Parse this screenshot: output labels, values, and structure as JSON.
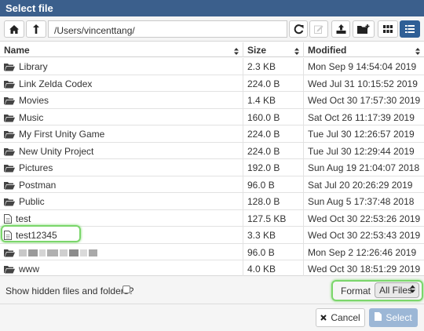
{
  "dialog": {
    "title": "Select file"
  },
  "toolbar": {
    "path": "/Users/vincenttang/",
    "buttons": {
      "home": "home-icon",
      "up": "arrow-up-icon",
      "refresh": "refresh-icon",
      "edit": "pencil-icon",
      "upload": "upload-icon",
      "new_folder": "folder-plus-icon",
      "grid_view": "grid-icon",
      "list_view": "list-icon"
    }
  },
  "table": {
    "columns": [
      "Name",
      "Size",
      "Modified"
    ],
    "rows": [
      {
        "type": "folder",
        "name": "Library",
        "size": "2.3 KB",
        "modified": "Mon Sep 9 14:54:04 2019"
      },
      {
        "type": "folder",
        "name": "Link Zelda Codex",
        "size": "224.0 B",
        "modified": "Wed Jul 31 10:15:52 2019"
      },
      {
        "type": "folder",
        "name": "Movies",
        "size": "1.4 KB",
        "modified": "Wed Oct 30 17:57:30 2019"
      },
      {
        "type": "folder",
        "name": "Music",
        "size": "160.0 B",
        "modified": "Sat Oct 26 11:17:39 2019"
      },
      {
        "type": "folder",
        "name": "My First Unity Game",
        "size": "224.0 B",
        "modified": "Tue Jul 30 12:26:57 2019"
      },
      {
        "type": "folder",
        "name": "New Unity Project",
        "size": "224.0 B",
        "modified": "Tue Jul 30 12:29:44 2019"
      },
      {
        "type": "folder",
        "name": "Pictures",
        "size": "192.0 B",
        "modified": "Sun Aug 19 21:04:07 2018"
      },
      {
        "type": "folder",
        "name": "Postman",
        "size": "96.0 B",
        "modified": "Sat Jul 20 20:26:29 2019"
      },
      {
        "type": "folder",
        "name": "Public",
        "size": "128.0 B",
        "modified": "Sun Aug 5 17:37:48 2018"
      },
      {
        "type": "file",
        "name": "test",
        "size": "127.5 KB",
        "modified": "Wed Oct 30 22:53:26 2019"
      },
      {
        "type": "file",
        "name": "test12345",
        "size": "3.3 KB",
        "modified": "Wed Oct 30 22:53:43 2019"
      },
      {
        "type": "folder",
        "name": "",
        "size": "96.0 B",
        "modified": "Mon Sep 2 12:26:46 2019"
      },
      {
        "type": "folder",
        "name": "www",
        "size": "4.0 KB",
        "modified": "Wed Oct 30 18:51:29 2019"
      }
    ]
  },
  "footer": {
    "show_hidden_label": "Show hidden files and folders?",
    "show_hidden_checked": false,
    "format_label": "Format",
    "format_value": "All Files",
    "cancel_label": "Cancel",
    "select_label": "Select"
  },
  "colors": {
    "titlebar": "#3b5f8c",
    "highlight": "#7bd66b",
    "select_button": "#9cb7d6",
    "active_view": "#2f5f96"
  }
}
